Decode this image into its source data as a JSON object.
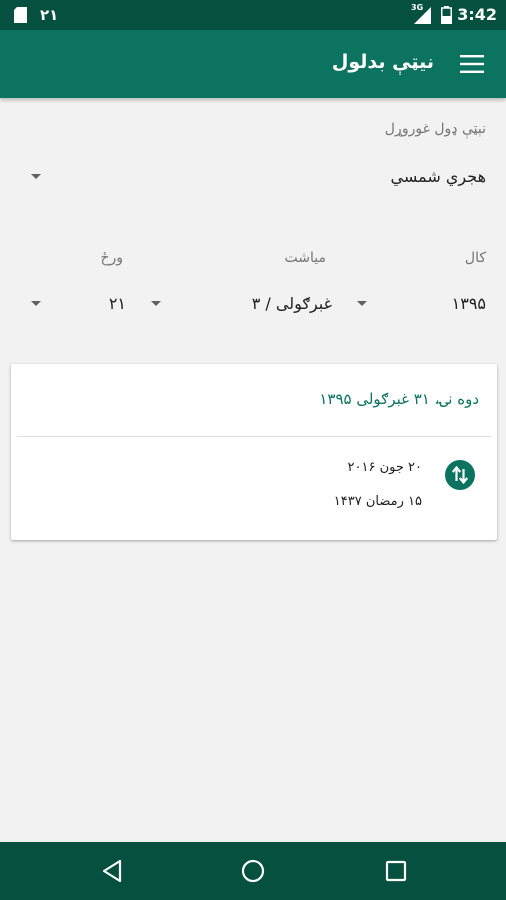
{
  "status_bar": {
    "notification_count": "۲۱",
    "network_type": "3G",
    "time": "3:42"
  },
  "app_bar": {
    "title": "نیټې بدلول",
    "menu_icon": "hamburger-menu-icon"
  },
  "source_calendar": {
    "label": "نېټې ډول غوروړل",
    "selected": "هجري شمسي"
  },
  "date_fields": {
    "year": {
      "label": "کال",
      "value": "۱۳۹۵"
    },
    "month": {
      "label": "میاشت",
      "value": "غبرګولی / ۳"
    },
    "day": {
      "label": "ورځ",
      "value": "۲۱"
    }
  },
  "result": {
    "heading": "دوه نۍ، ۳۱ غبرګولی ۱۳۹۵",
    "gregorian": "۲۰ جون ۲۰۱۶",
    "hijri_qamari": "۱۵ رمضان ۱۴۳۷"
  },
  "colors": {
    "primary": "#0b7360",
    "primary_dark": "#06503f",
    "background": "#f2f2f2"
  }
}
